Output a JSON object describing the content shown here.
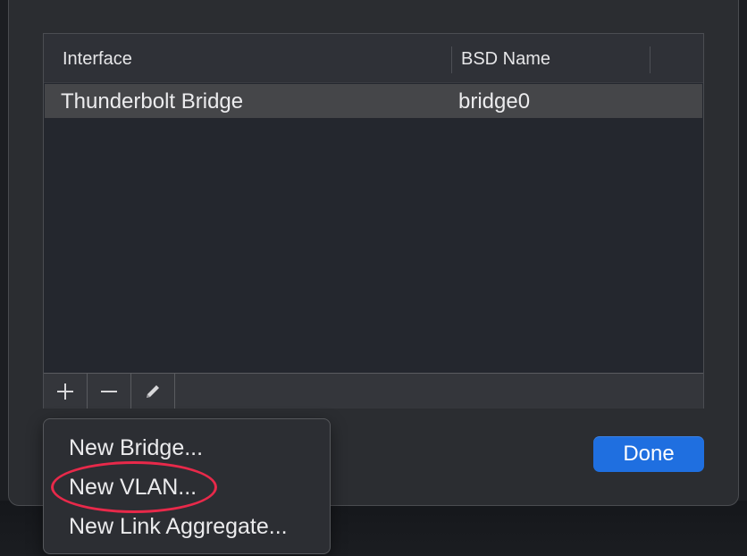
{
  "table": {
    "columns": [
      "Interface",
      "BSD Name"
    ],
    "rows": [
      {
        "interface": "Thunderbolt Bridge",
        "bsd_name": "bridge0"
      }
    ]
  },
  "toolbar": {
    "add_icon": "plus-icon",
    "remove_icon": "minus-icon",
    "edit_icon": "pencil-icon"
  },
  "done_label": "Done",
  "menu": {
    "items": [
      "New Bridge...",
      "New VLAN...",
      "New Link Aggregate..."
    ],
    "highlighted_item": "New VLAN..."
  },
  "colors": {
    "accent": "#1f6fe0",
    "annotation": "#e8294a",
    "selected_row": "#454649"
  }
}
